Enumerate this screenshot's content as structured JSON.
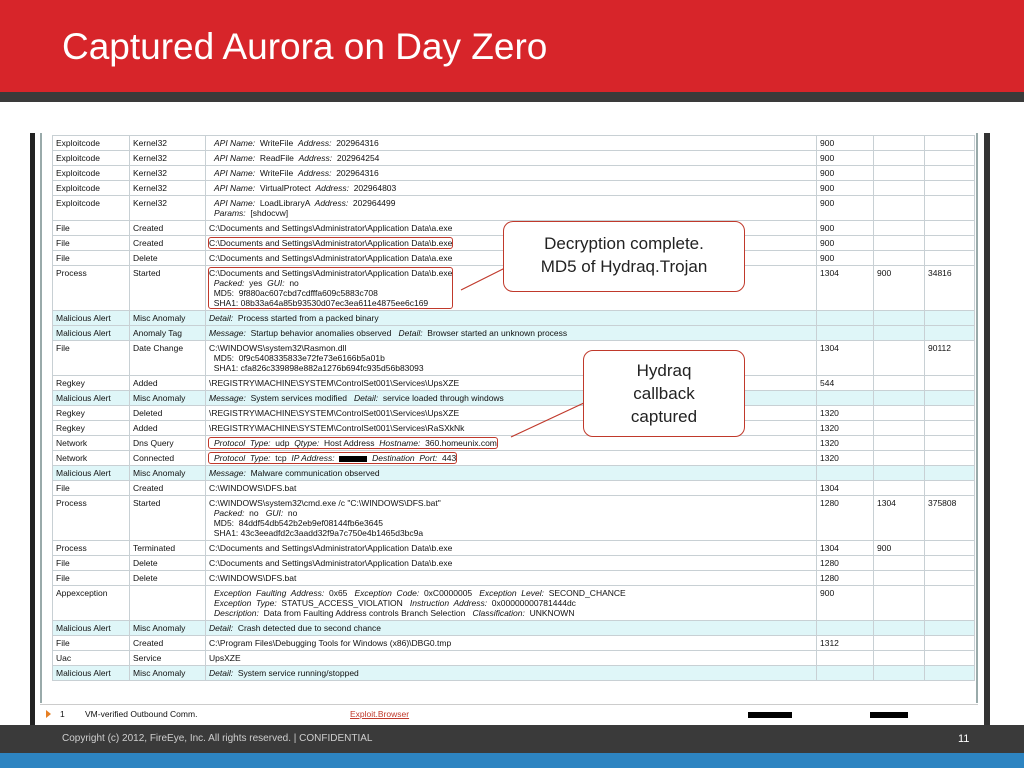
{
  "slide": {
    "title": "Captured Aurora on Day Zero",
    "footer": "Copyright (c) 2012, FireEye, Inc. All rights reserved. | CONFIDENTIAL",
    "page_number": "11"
  },
  "callouts": {
    "decryption": [
      "Decryption complete.",
      "MD5 of Hydraq.Trojan"
    ],
    "hydraq": [
      "Hydraq",
      "callback",
      "captured"
    ]
  },
  "colors": {
    "header_red": "#d7252a",
    "dark_bar": "#3a3a3a",
    "accent_blue": "#2d84c1",
    "alert_row": "#dff6f8",
    "highlight": "#c0392b"
  },
  "table": {
    "rows": [
      {
        "c1": "Exploitcode",
        "c2": "Kernel32",
        "lines": [
          [
            {
              "t": "API Name:",
              "k": 1
            },
            {
              "t": "  WriteFile  "
            },
            {
              "t": "Address:",
              "k": 1
            },
            {
              "t": "  202964316"
            }
          ]
        ],
        "c4": "900",
        "c5": "",
        "c6": "",
        "indent": 1
      },
      {
        "c1": "Exploitcode",
        "c2": "Kernel32",
        "lines": [
          [
            {
              "t": "API Name:",
              "k": 1
            },
            {
              "t": "  ReadFile  "
            },
            {
              "t": "Address:",
              "k": 1
            },
            {
              "t": "  202964254"
            }
          ]
        ],
        "c4": "900",
        "c5": "",
        "c6": "",
        "indent": 1
      },
      {
        "c1": "Exploitcode",
        "c2": "Kernel32",
        "lines": [
          [
            {
              "t": "API Name:",
              "k": 1
            },
            {
              "t": "  WriteFile  "
            },
            {
              "t": "Address:",
              "k": 1
            },
            {
              "t": "  202964316"
            }
          ]
        ],
        "c4": "900",
        "c5": "",
        "c6": "",
        "indent": 1
      },
      {
        "c1": "Exploitcode",
        "c2": "Kernel32",
        "lines": [
          [
            {
              "t": "API Name:",
              "k": 1
            },
            {
              "t": "  VirtualProtect  "
            },
            {
              "t": "Address:",
              "k": 1
            },
            {
              "t": "  202964803"
            }
          ]
        ],
        "c4": "900",
        "c5": "",
        "c6": "",
        "indent": 1
      },
      {
        "c1": "Exploitcode",
        "c2": "Kernel32",
        "lines": [
          [
            {
              "t": "API Name:",
              "k": 1
            },
            {
              "t": "  LoadLibraryA  "
            },
            {
              "t": "Address:",
              "k": 1
            },
            {
              "t": "  202964499"
            }
          ],
          [
            {
              "t": "Params:",
              "k": 1
            },
            {
              "t": "  [shdocvw]"
            }
          ]
        ],
        "c4": "900",
        "c5": "",
        "c6": "",
        "indent": 1
      },
      {
        "c1": "File",
        "c2": "Created",
        "lines": [
          [
            {
              "t": "C:\\Documents and Settings\\Administrator\\Application Data\\a.exe"
            }
          ]
        ],
        "c4": "900",
        "c5": "",
        "c6": ""
      },
      {
        "c1": "File",
        "c2": "Created",
        "lines": [
          [
            {
              "t": "C:\\Documents and Settings\\Administrator\\Application Data\\b.exe"
            }
          ]
        ],
        "c4": "900",
        "c5": "",
        "c6": "",
        "hl": 1
      },
      {
        "c1": "File",
        "c2": "Delete",
        "lines": [
          [
            {
              "t": "C:\\Documents and Settings\\Administrator\\Application Data\\a.exe"
            }
          ]
        ],
        "c4": "900",
        "c5": "",
        "c6": ""
      },
      {
        "c1": "Process",
        "c2": "Started",
        "lines": [
          [
            {
              "t": "C:\\Documents and Settings\\Administrator\\Application Data\\b.exe"
            }
          ],
          [
            {
              "t": "  Packed:",
              "k": 1
            },
            {
              "t": "  yes  "
            },
            {
              "t": "GUI:",
              "k": 1
            },
            {
              "t": "  no"
            }
          ],
          [
            {
              "t": "  MD5:  9f880ac607cbd7cdfffa609c5883c708"
            }
          ],
          [
            {
              "t": "  SHA1: 08b33a64a85b93530d07ec3ea611e4875ee6c169"
            }
          ]
        ],
        "c4": "1304",
        "c5": "900",
        "c6": "34816",
        "hl": 1
      },
      {
        "c1": "Malicious  Alert",
        "c2": "Misc  Anomaly",
        "lines": [
          [
            {
              "t": "Detail:",
              "k": 1
            },
            {
              "t": "  Process started from a packed binary"
            }
          ]
        ],
        "c4": "",
        "c5": "",
        "c6": "",
        "alert": 1
      },
      {
        "c1": "Malicious  Alert",
        "c2": "Anomaly  Tag",
        "lines": [
          [
            {
              "t": "Message:",
              "k": 1
            },
            {
              "t": "  Startup behavior anomalies observed   "
            },
            {
              "t": "Detail:",
              "k": 1
            },
            {
              "t": "  Browser started an unknown process"
            }
          ]
        ],
        "c4": "",
        "c5": "",
        "c6": "",
        "alert": 1
      },
      {
        "c1": "File",
        "c2": "Date  Change",
        "lines": [
          [
            {
              "t": "C:\\WINDOWS\\system32\\Rasmon.dll"
            }
          ],
          [
            {
              "t": "  MD5:  0f9c5408335833e72fe73e6166b5a01b"
            }
          ],
          [
            {
              "t": "  SHA1: cfa826c339898e882a1276b694fc935d56b83093"
            }
          ]
        ],
        "c4": "1304",
        "c5": "",
        "c6": "90112"
      },
      {
        "c1": "Regkey",
        "c2": "Added",
        "lines": [
          [
            {
              "t": "\\REGISTRY\\MACHINE\\SYSTEM\\ControlSet001\\Services\\UpsXZE"
            }
          ]
        ],
        "c4": "544",
        "c5": "",
        "c6": ""
      },
      {
        "c1": "Malicious  Alert",
        "c2": "Misc  Anomaly",
        "lines": [
          [
            {
              "t": "Message:",
              "k": 1
            },
            {
              "t": "  System services modified   "
            },
            {
              "t": "Detail:",
              "k": 1
            },
            {
              "t": "  service loaded through windows"
            }
          ]
        ],
        "c4": "",
        "c5": "",
        "c6": "",
        "alert": 1
      },
      {
        "c1": "Regkey",
        "c2": "Deleted",
        "lines": [
          [
            {
              "t": "\\REGISTRY\\MACHINE\\SYSTEM\\ControlSet001\\Services\\UpsXZE"
            }
          ]
        ],
        "c4": "1320",
        "c5": "",
        "c6": ""
      },
      {
        "c1": "Regkey",
        "c2": "Added",
        "lines": [
          [
            {
              "t": "\\REGISTRY\\MACHINE\\SYSTEM\\ControlSet001\\Services\\RaSXkNk"
            }
          ]
        ],
        "c4": "1320",
        "c5": "",
        "c6": ""
      },
      {
        "c1": "Network",
        "c2": "Dns  Query",
        "lines": [
          [
            {
              "t": "Protocol  Type:",
              "k": 1
            },
            {
              "t": "  udp  "
            },
            {
              "t": "Qtype:",
              "k": 1
            },
            {
              "t": "  Host Address  "
            },
            {
              "t": "Hostname:",
              "k": 1
            },
            {
              "t": "  360.homeunix.com"
            }
          ]
        ],
        "c4": "1320",
        "c5": "",
        "c6": "",
        "indent": 1,
        "hl": 1
      },
      {
        "c1": "Network",
        "c2": "Connected",
        "lines": [
          [
            {
              "t": "Protocol  Type:",
              "k": 1
            },
            {
              "t": "  tcp  "
            },
            {
              "t": "IP Address:",
              "k": 1
            },
            {
              "t": "  "
            },
            {
              "redact": 1
            },
            {
              "t": "  "
            },
            {
              "t": "Destination  Port:",
              "k": 1
            },
            {
              "t": "  443"
            }
          ]
        ],
        "c4": "1320",
        "c5": "",
        "c6": "",
        "indent": 1,
        "hl": 1
      },
      {
        "c1": "Malicious  Alert",
        "c2": "Misc  Anomaly",
        "lines": [
          [
            {
              "t": "Message:",
              "k": 1
            },
            {
              "t": "  Malware communication observed"
            }
          ]
        ],
        "c4": "",
        "c5": "",
        "c6": "",
        "alert": 1
      },
      {
        "c1": "File",
        "c2": "Created",
        "lines": [
          [
            {
              "t": "C:\\WINDOWS\\DFS.bat"
            }
          ]
        ],
        "c4": "1304",
        "c5": "",
        "c6": ""
      },
      {
        "c1": "Process",
        "c2": "Started",
        "lines": [
          [
            {
              "t": "C:\\WINDOWS\\system32\\cmd.exe /c \"C:\\WINDOWS\\DFS.bat\""
            }
          ],
          [
            {
              "t": "  Packed:",
              "k": 1
            },
            {
              "t": "  no   "
            },
            {
              "t": "GUI:",
              "k": 1
            },
            {
              "t": "  no"
            }
          ],
          [
            {
              "t": "  MD5:  84ddf54db542b2eb9ef08144fb6e3645"
            }
          ],
          [
            {
              "t": "  SHA1: 43c3eeadfd2c3aadd32f9a7c750e4b1465d3bc9a"
            }
          ]
        ],
        "c4": "1280",
        "c5": "1304",
        "c6": "375808"
      },
      {
        "c1": "Process",
        "c2": "Terminated",
        "lines": [
          [
            {
              "t": "C:\\Documents and Settings\\Administrator\\Application Data\\b.exe"
            }
          ]
        ],
        "c4": "1304",
        "c5": "900",
        "c6": ""
      },
      {
        "c1": "File",
        "c2": "Delete",
        "lines": [
          [
            {
              "t": "C:\\Documents and Settings\\Administrator\\Application Data\\b.exe"
            }
          ]
        ],
        "c4": "1280",
        "c5": "",
        "c6": ""
      },
      {
        "c1": "File",
        "c2": "Delete",
        "lines": [
          [
            {
              "t": "C:\\WINDOWS\\DFS.bat"
            }
          ]
        ],
        "c4": "1280",
        "c5": "",
        "c6": ""
      },
      {
        "c1": "Appexception",
        "c2": "",
        "lines": [
          [
            {
              "t": "Exception  Faulting  Address:",
              "k": 1
            },
            {
              "t": "  0x65   "
            },
            {
              "t": "Exception  Code:",
              "k": 1
            },
            {
              "t": "  0xC0000005   "
            },
            {
              "t": "Exception  Level:",
              "k": 1
            },
            {
              "t": "  SECOND_CHANCE"
            }
          ],
          [
            {
              "t": "Exception  Type:",
              "k": 1
            },
            {
              "t": "  STATUS_ACCESS_VIOLATION   "
            },
            {
              "t": "Instruction  Address:",
              "k": 1
            },
            {
              "t": "  0x00000000781444dc"
            }
          ],
          [
            {
              "t": "Description:",
              "k": 1
            },
            {
              "t": "  Data from Faulting Address controls Branch Selection   "
            },
            {
              "t": "Classification:",
              "k": 1
            },
            {
              "t": "  UNKNOWN"
            }
          ]
        ],
        "c4": "900",
        "c5": "",
        "c6": "",
        "indent": 1
      },
      {
        "c1": "Malicious  Alert",
        "c2": "Misc  Anomaly",
        "lines": [
          [
            {
              "t": "Detail:",
              "k": 1
            },
            {
              "t": "  Crash detected due to second chance"
            }
          ]
        ],
        "c4": "",
        "c5": "",
        "c6": "",
        "alert": 1
      },
      {
        "c1": "File",
        "c2": "Created",
        "lines": [
          [
            {
              "t": "C:\\Program Files\\Debugging Tools for Windows (x86)\\DBG0.tmp"
            }
          ]
        ],
        "c4": "1312",
        "c5": "",
        "c6": ""
      },
      {
        "c1": "Uac",
        "c2": "Service",
        "lines": [
          [
            {
              "t": "UpsXZE"
            }
          ]
        ],
        "c4": "",
        "c5": "",
        "c6": ""
      },
      {
        "c1": "Malicious  Alert",
        "c2": "Misc  Anomaly",
        "lines": [
          [
            {
              "t": "Detail:",
              "k": 1
            },
            {
              "t": "  System service running/stopped"
            }
          ]
        ],
        "c4": "",
        "c5": "",
        "c6": "",
        "alert": 1
      }
    ]
  },
  "bottom_row": {
    "index": "1",
    "name": "VM-verified Outbound Comm.",
    "link": "Exploit.Browser"
  }
}
